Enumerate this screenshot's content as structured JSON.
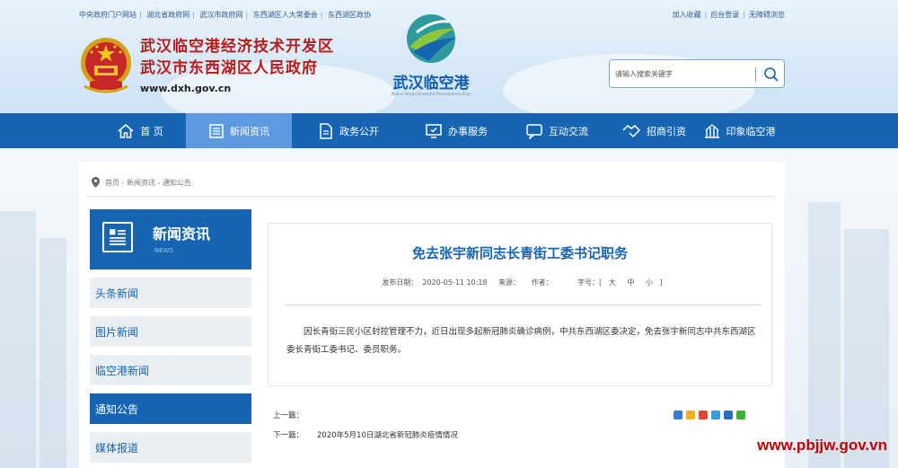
{
  "top_links": {
    "left": [
      "中央政府门户网站",
      "湖北省政府网",
      "武汉市政府网",
      "东西湖区人大常委会",
      "东西湖区政协"
    ],
    "right": [
      "加入收藏",
      "后台登录",
      "无障碍浏览"
    ]
  },
  "site": {
    "title_line1": "武汉临空港经济技术开发区",
    "title_line2": "武汉市东西湖区人民政府",
    "url": "www.dxh.gov.cn",
    "logo_name": "武汉临空港",
    "logo_sub": "Wuhan Airport Economic Development Zone"
  },
  "search": {
    "placeholder": "请输入搜索关键字"
  },
  "nav": [
    "首 页",
    "新闻资讯",
    "政务公开",
    "办事服务",
    "互动交流",
    "招商引资",
    "印象临空港"
  ],
  "breadcrumb": "首页 - 新闻资讯 - 通知公告",
  "sidebar": {
    "title": "新闻资讯",
    "subtitle": "NEWS",
    "items": [
      "头条新闻",
      "图片新闻",
      "临空港新闻",
      "通知公告",
      "媒体报道"
    ],
    "active_index": 3
  },
  "article": {
    "title": "免去张宇新同志长青街工委书记职务",
    "date_label": "发布日期：",
    "date": "2020-05-11 10:18",
    "source_label": "来源：",
    "author_label": "作者：",
    "font_label": "字号：[",
    "font_sizes": [
      "大",
      "中",
      "小"
    ],
    "font_close": "]",
    "body": "因长青街三民小区封控管理不力，近日出现多起新冠肺炎确诊病例，中共东西湖区委决定，免去张宇新同志中共东西湖区委长青街工委书记、委员职务。"
  },
  "pager": {
    "prev_label": "上一篇：",
    "prev_title": "",
    "next_label": "下一篇：",
    "next_title": "2020年5月10日湖北省新冠肺炎疫情情况"
  },
  "share_icons": [
    "share-plus-icon",
    "qzone-icon",
    "weibo-icon",
    "tencent-weibo-icon",
    "renren-icon",
    "wechat-icon"
  ],
  "watermark": "www.pbjjw.gov.vn",
  "colors": {
    "primary": "#1565b3",
    "nav_active": "#5d9ae0",
    "title_red": "#b71c1c",
    "watermark": "#c00000"
  }
}
